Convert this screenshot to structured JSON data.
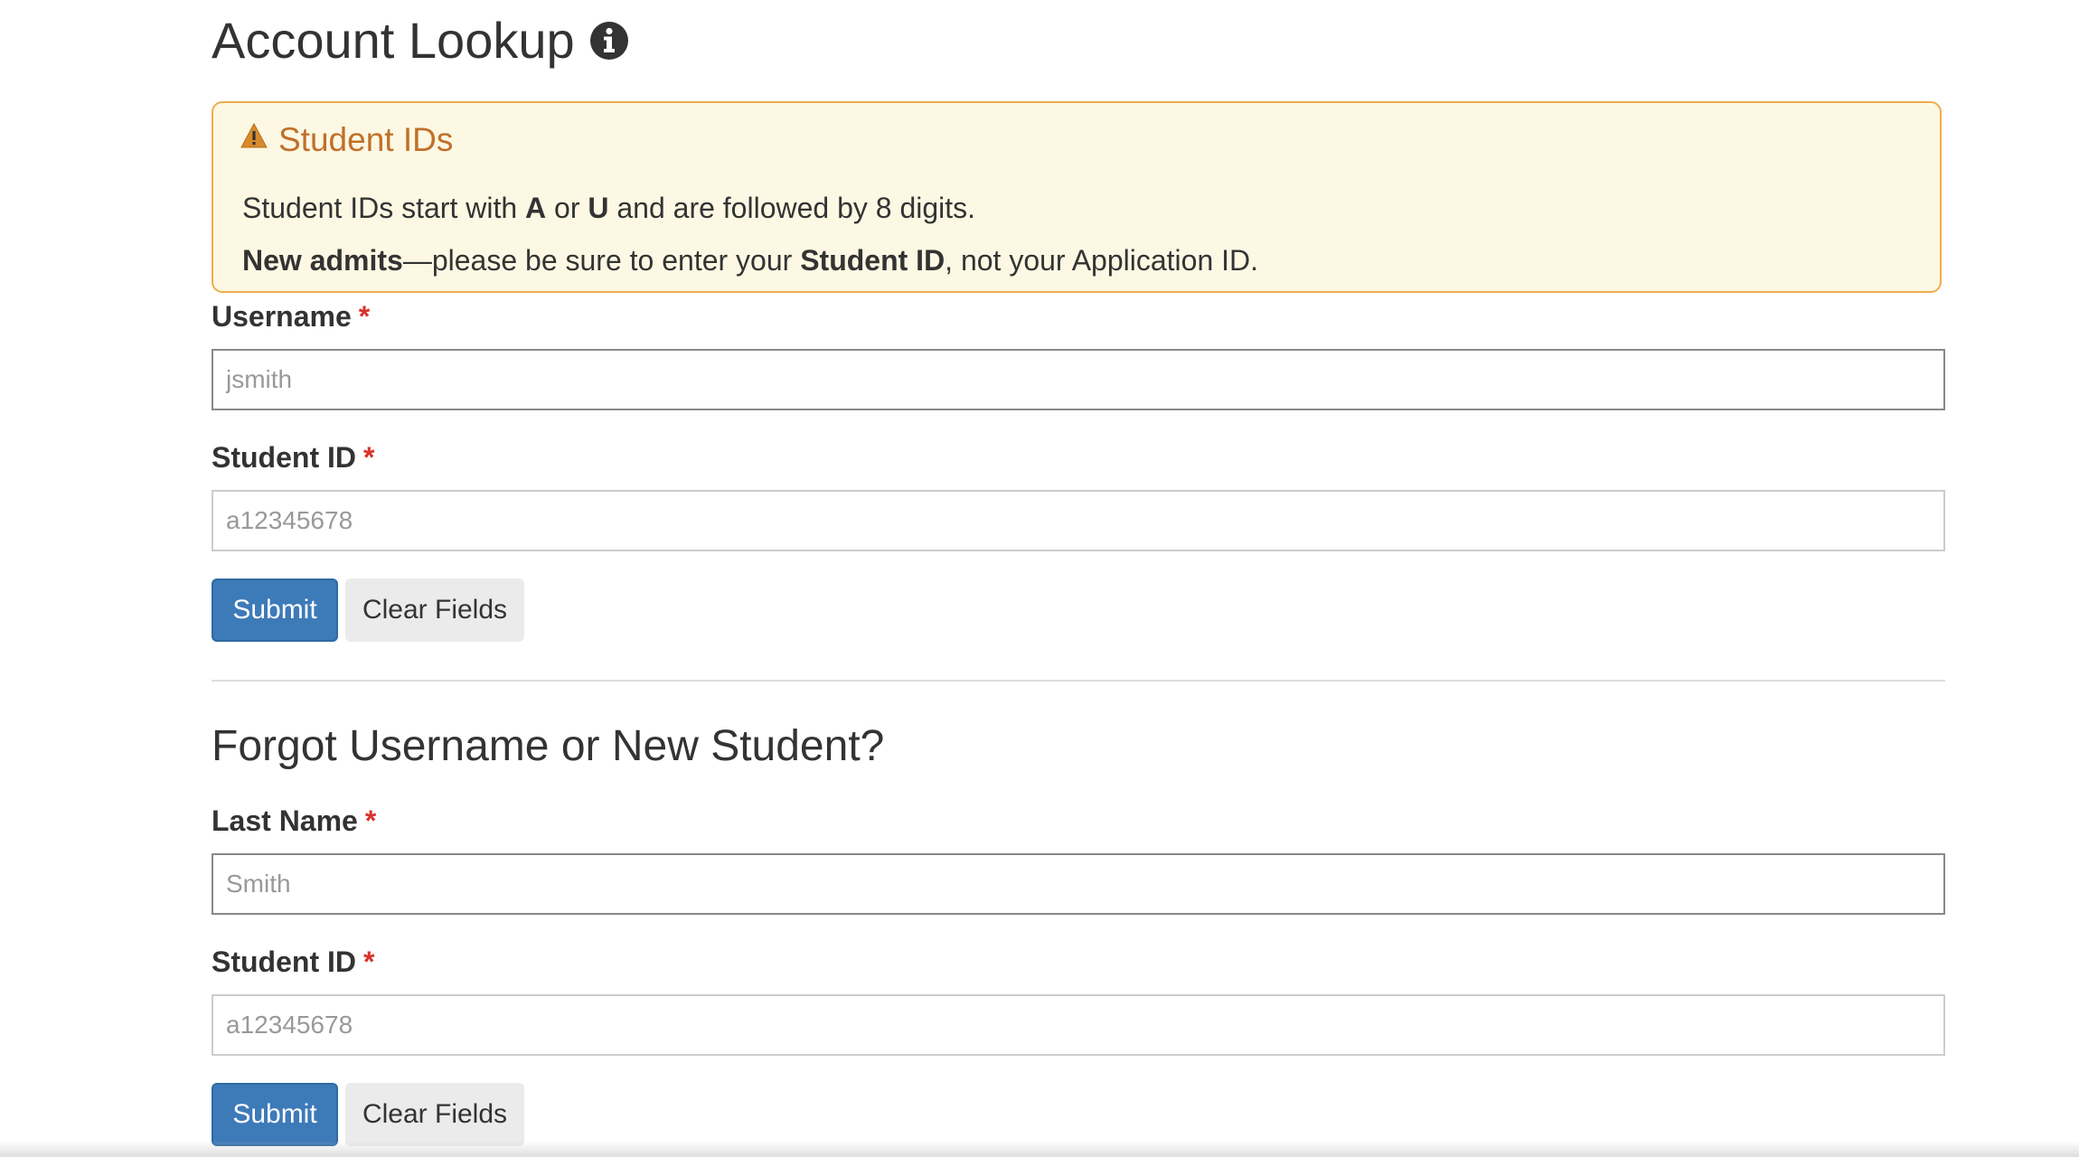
{
  "page": {
    "title": "Account Lookup"
  },
  "alert": {
    "heading": "Student IDs",
    "line1": {
      "part1": "Student IDs start with ",
      "bold1": "A",
      "part2": " or ",
      "bold2": "U",
      "part3": " and are followed by 8 digits."
    },
    "line2": {
      "bold1": "New admits",
      "part1": "—please be sure to enter your ",
      "bold2": "Student ID",
      "part2": ", not your Application ID."
    }
  },
  "lookup_form": {
    "username_label": "Username",
    "username_placeholder": "jsmith",
    "student_id_label": "Student ID",
    "student_id_placeholder": "a12345678",
    "required_mark": "*",
    "submit_label": "Submit",
    "clear_label": "Clear Fields"
  },
  "forgot_form": {
    "title": "Forgot Username or New Student?",
    "last_name_label": "Last Name",
    "last_name_placeholder": "Smith",
    "student_id_label": "Student ID",
    "student_id_placeholder": "a12345678",
    "required_mark": "*",
    "submit_label": "Submit",
    "clear_label": "Clear Fields"
  },
  "colors": {
    "primary_button": "#3d7ab8",
    "alert_background": "#fcf8e3",
    "alert_border": "#f0ad4e",
    "alert_heading": "#c0702a",
    "required": "#d9302c"
  },
  "icons": {
    "title_icon": "info-circle-icon",
    "alert_icon": "warning-triangle-icon"
  }
}
